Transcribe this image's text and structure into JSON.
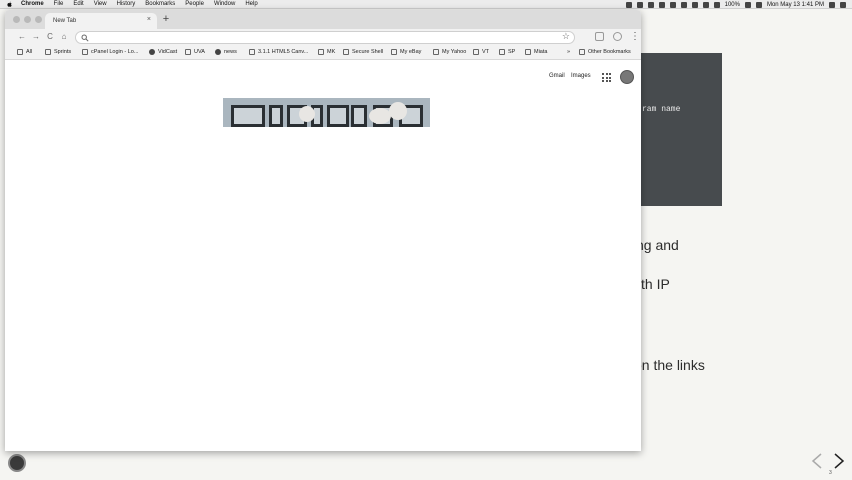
{
  "menubar": {
    "app_name": "Chrome",
    "menus": [
      "File",
      "Edit",
      "View",
      "History",
      "Bookmarks",
      "People",
      "Window",
      "Help"
    ],
    "battery": "100%",
    "clock": "Mon May 13  1:41 PM"
  },
  "browser": {
    "tab_title": "New Tab",
    "tab_close": "×",
    "new_tab": "+",
    "back": "←",
    "forward": "→",
    "reload": "C",
    "home": "⌂",
    "star": "☆",
    "menu": "⋮",
    "bookmarks": [
      "All",
      "Sprints",
      "cPanel Login - Lo...",
      "VidCast",
      "UVA",
      "news",
      "3.1.1 HTML5 Canv...",
      "MK",
      "Secure Shell",
      "My eBay",
      "My Yahoo",
      "VT",
      "SP",
      "Miata"
    ],
    "more_bookmarks": "»",
    "other_bookmarks": "Other Bookmarks"
  },
  "google_page": {
    "gmail": "Gmail",
    "images": "Images"
  },
  "slide": {
    "code_text": "ram name",
    "line1": "ng and",
    "line2": "th IP",
    "line3": "on the links",
    "slide_number": "3"
  },
  "colors": {
    "code_box": "#474b4e",
    "window_bg": "#ffffff",
    "tabstrip": "#dcdcdc"
  }
}
